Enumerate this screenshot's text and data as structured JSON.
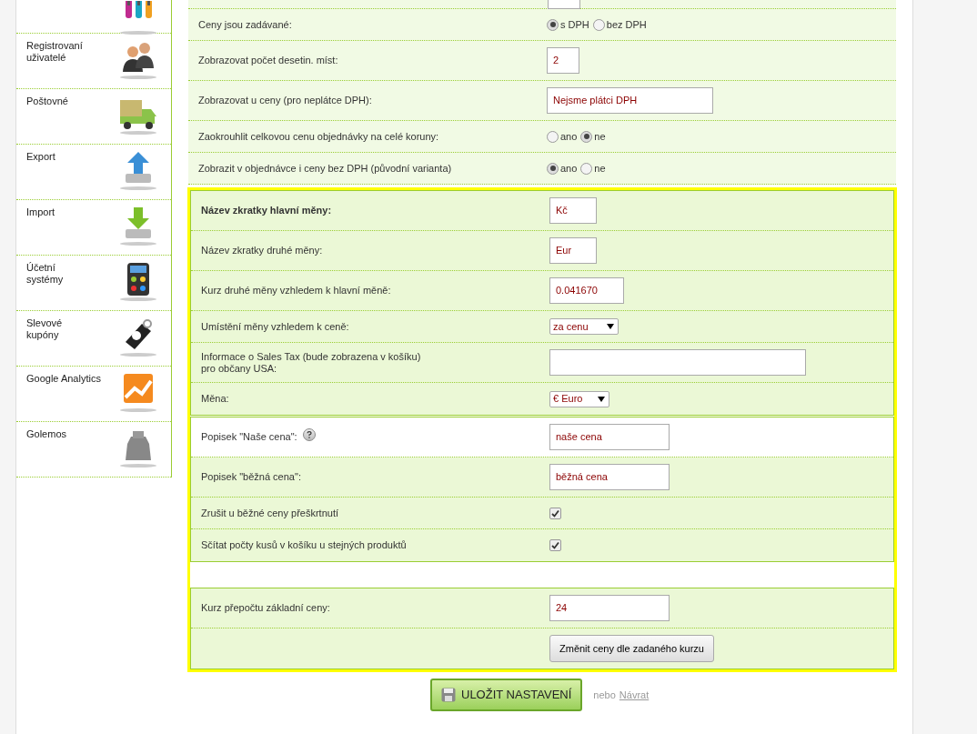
{
  "sidebar": {
    "items": [
      {
        "label": "Registrovaní\nuživatelé"
      },
      {
        "label": "Poštovné"
      },
      {
        "label": "Export"
      },
      {
        "label": "Import"
      },
      {
        "label": "Účetní\nsystémy"
      },
      {
        "label": "Slevové\nkupóny"
      },
      {
        "label": "Google Analytics"
      },
      {
        "label": "Golemos"
      }
    ]
  },
  "sections": [
    {
      "kind": "plain",
      "groups": [
        {
          "rows": [
            {
              "kind": "radio",
              "label": "Ceny jsou zadávané:",
              "options": [
                {
                  "label": "s DPH",
                  "selected": true
                },
                {
                  "label": "bez DPH",
                  "selected": false
                }
              ]
            },
            {
              "kind": "input",
              "label": "Zobrazovat počet desetin. míst:",
              "value": "2"
            },
            {
              "kind": "input",
              "label": "Zobrazovat u ceny (pro neplátce DPH):",
              "value": "Nejsme plátci DPH"
            },
            {
              "kind": "radio",
              "label": "Zaokrouhlit celkovou cenu objednávky na celé koruny:",
              "options": [
                {
                  "label": "ano",
                  "selected": false
                },
                {
                  "label": "ne",
                  "selected": true
                }
              ]
            },
            {
              "kind": "radio",
              "label": "Zobrazit v objednávce i ceny bez DPH (původní varianta)",
              "options": [
                {
                  "label": "ano",
                  "selected": true
                },
                {
                  "label": "ne",
                  "selected": false
                }
              ]
            }
          ]
        }
      ]
    },
    {
      "kind": "highlighted",
      "groups": [
        {
          "rows": [
            {
              "kind": "input",
              "label": "Název zkratky hlavní měny:",
              "bold": true,
              "value": "Kč"
            },
            {
              "kind": "input",
              "label": "Název zkratky druhé měny:",
              "value": "Eur"
            },
            {
              "kind": "input",
              "label": "Kurz druhé měny vzhledem k hlavní měně:",
              "value": "0.041670"
            },
            {
              "kind": "select",
              "label": "Umístění měny vzhledem k ceně:",
              "value": "za cenu"
            },
            {
              "kind": "input",
              "label": "Informace o Sales Tax (bude zobrazena v košíku)\npro občany USA:"
            },
            {
              "kind": "select",
              "label": "Měna:",
              "value": "€ Euro"
            }
          ]
        },
        {
          "rows": [
            {
              "kind": "input",
              "label": "Popisek \"Naše cena\":",
              "help": true,
              "white": true,
              "value": "naše cena"
            },
            {
              "kind": "input",
              "label": "Popisek \"běžná cena\":",
              "value": "běžná cena"
            },
            {
              "kind": "checkbox",
              "label": "Zrušit u běžné ceny přeškrtnutí",
              "checked": true
            },
            {
              "kind": "checkbox",
              "label": "Sčítat počty kusů v košíku u stejných produktů",
              "checked": true
            }
          ]
        },
        {
          "rows": [
            {
              "kind": "input",
              "label": "Kurz přepočtu základní ceny:",
              "value": "24"
            },
            {
              "kind": "button",
              "value": "Změnit ceny dle zadaného kurzu"
            }
          ]
        }
      ]
    }
  ],
  "save": {
    "label": "ULOŽIT NASTAVENÍ",
    "or": "nebo",
    "back": "Návrat"
  }
}
